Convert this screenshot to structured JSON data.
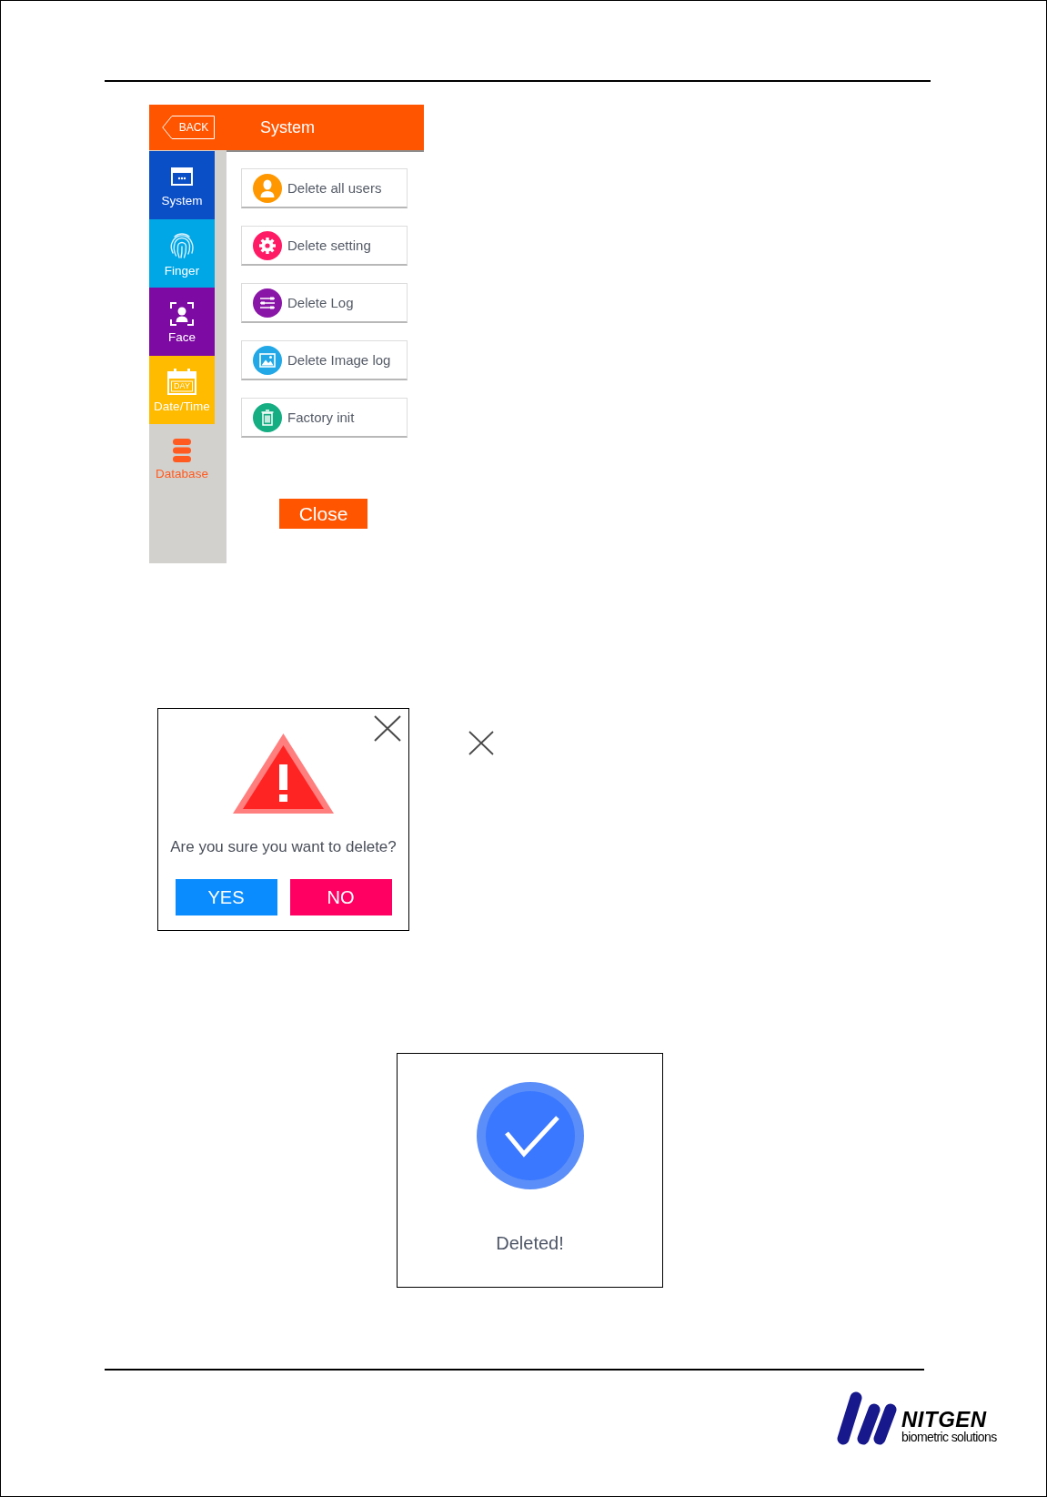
{
  "device_screen": {
    "back_button": "BACK",
    "title": "System",
    "sidebar": {
      "items": [
        {
          "label": "System",
          "color": "#0b4fc6",
          "selected": false
        },
        {
          "label": "Finger",
          "color": "#00a7e6",
          "selected": false
        },
        {
          "label": "Face",
          "color": "#7d0aa2",
          "selected": false
        },
        {
          "label": "Date/Time",
          "color": "#ffbb00",
          "selected": false,
          "icon_text": "DAY"
        },
        {
          "label": "Database",
          "color": "#ff5a1f",
          "selected": true
        }
      ]
    },
    "options": [
      {
        "label": "Delete all users",
        "color": "#ff9800"
      },
      {
        "label": "Delete setting",
        "color": "#ff1a66"
      },
      {
        "label": "Delete Log",
        "color": "#8a16a8"
      },
      {
        "label": "Delete Image log",
        "color": "#22a8e6"
      },
      {
        "label": "Factory init",
        "color": "#15ad82"
      }
    ],
    "close_button": "Close"
  },
  "confirm_dialog": {
    "message": "Are you sure you want to delete?",
    "buttons": [
      {
        "label": "YES",
        "kind": "confirm"
      },
      {
        "label": "NO",
        "kind": "cancel"
      }
    ]
  },
  "done_dialog": {
    "message": "Deleted!"
  },
  "footer": {
    "brand": "NITGEN",
    "tagline": "biometric solutions"
  }
}
